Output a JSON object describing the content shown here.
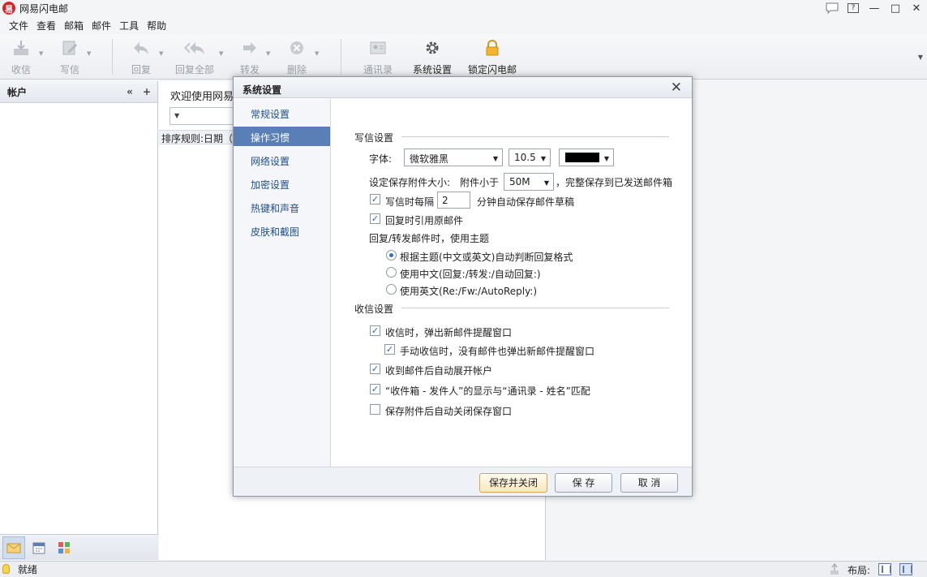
{
  "app": {
    "title": "网易闪电邮",
    "logo_char": "易"
  },
  "window_controls": {
    "help": "?",
    "minimize": "—",
    "maximize": "□",
    "close": "✕"
  },
  "menu": [
    "文件",
    "查看",
    "邮箱",
    "邮件",
    "工具",
    "帮助"
  ],
  "toolbar": {
    "receive": "收信",
    "compose": "写信",
    "reply": "回复",
    "reply_all": "回复全部",
    "forward": "转发",
    "delete": "删除",
    "contacts": "通讯录",
    "settings": "系统设置",
    "lock": "锁定闪电邮"
  },
  "left_panel": {
    "title": "帐户",
    "collapse": "«",
    "add": "+"
  },
  "mid_panel": {
    "welcome": "欢迎使用网易",
    "filter_arrow": "▼",
    "sort_label": "排序规则:日期（"
  },
  "status": {
    "text": "就绪",
    "layout_label": "布局:"
  },
  "dialog": {
    "title": "系统设置",
    "close": "✕",
    "nav": [
      "常规设置",
      "操作习惯",
      "网络设置",
      "加密设置",
      "热键和声音",
      "皮肤和截图"
    ],
    "active_nav_index": 1,
    "compose_group": "写信设置",
    "font_label": "字体:",
    "font_value": "微软雅黑",
    "font_size": "10.5",
    "font_color": "#000000",
    "attach_label": "设定保存附件大小:",
    "attach_prefix": "附件小于",
    "attach_value": "50M",
    "attach_suffix": "，完整保存到已发送邮件箱",
    "autosave_prefix": "写信时每隔",
    "autosave_value": "2",
    "autosave_suffix": "分钟自动保存邮件草稿",
    "quote_label": "回复时引用原邮件",
    "subject_label": "回复/转发邮件时，使用主题",
    "radio_auto": "根据主题(中文或英文)自动判断回复格式",
    "radio_cn": "使用中文(回复:/转发:/自动回复:)",
    "radio_en": "使用英文(Re:/Fw:/AutoReply:)",
    "receive_group": "收信设置",
    "popup_label": "收信时，弹出新邮件提醒窗口",
    "manual_popup_label": "手动收信时，没有邮件也弹出新邮件提醒窗口",
    "expand_label": "收到邮件后自动展开帐户",
    "match_label": "“收件箱 - 发件人”的显示与“通讯录 - 姓名”匹配",
    "close_attach_label": "保存附件后自动关闭保存窗口",
    "check": "✓",
    "btn_save_close": "保存并关闭",
    "btn_save": "保 存",
    "btn_cancel": "取 消"
  }
}
